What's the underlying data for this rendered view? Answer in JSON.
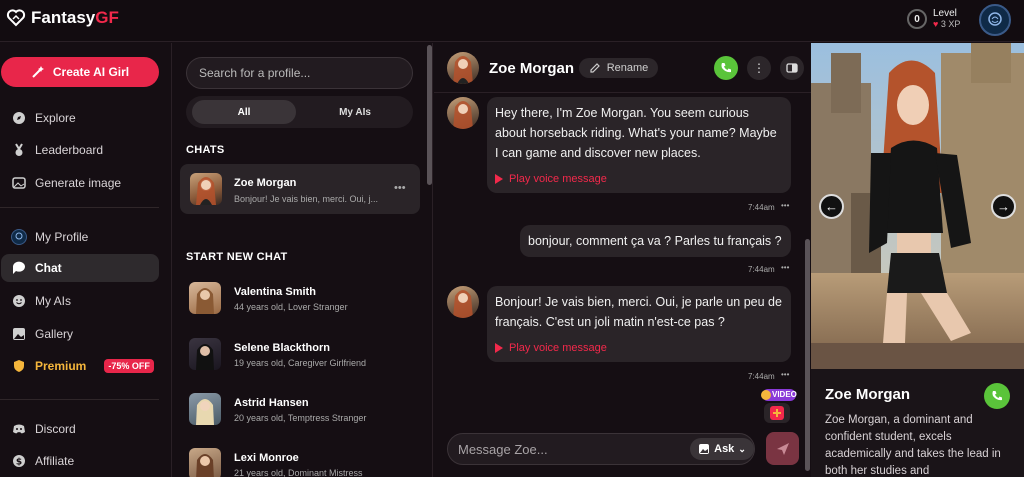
{
  "app": {
    "brand_a": "Fantasy",
    "brand_b": "GF",
    "level_label": "Level",
    "level_value": "0",
    "xp": "3 XP"
  },
  "sidebar": {
    "create_label": "Create AI Girl",
    "items": [
      {
        "label": "Explore",
        "icon": "compass-icon"
      },
      {
        "label": "Leaderboard",
        "icon": "medal-icon"
      },
      {
        "label": "Generate image",
        "icon": "image-icon"
      },
      {
        "label": "My Profile",
        "icon": "profile-icon"
      },
      {
        "label": "Chat",
        "icon": "chat-icon"
      },
      {
        "label": "My AIs",
        "icon": "smile-icon"
      },
      {
        "label": "Gallery",
        "icon": "gallery-icon"
      },
      {
        "label": "Premium",
        "icon": "shield-icon"
      },
      {
        "label": "Discord",
        "icon": "discord-icon"
      },
      {
        "label": "Affiliate",
        "icon": "dollar-icon"
      }
    ],
    "premium_discount": "-75% OFF"
  },
  "chatlist": {
    "search_placeholder": "Search for a profile...",
    "tab_all": "All",
    "tab_my_ais": "My AIs",
    "chats_title": "CHATS",
    "active_chat": {
      "name": "Zoe Morgan",
      "preview": "Bonjour! Je vais bien, merci. Oui, j..."
    },
    "start_title": "START NEW CHAT",
    "new_chats": [
      {
        "name": "Valentina Smith",
        "sub": "44 years old, Lover Stranger"
      },
      {
        "name": "Selene Blackthorn",
        "sub": "19 years old, Caregiver Girlfriend"
      },
      {
        "name": "Astrid Hansen",
        "sub": "20 years old, Temptress Stranger"
      },
      {
        "name": "Lexi Monroe",
        "sub": "21 years old, Dominant Mistress"
      }
    ]
  },
  "conversation": {
    "name": "Zoe Morgan",
    "rename_label": "Rename",
    "messages": [
      {
        "text": "Hey there, I'm Zoe Morgan. You seem curious about horseback riding. What's your name? Maybe I can game and discover new places.",
        "voice": "Play voice message",
        "time": "7:44am"
      },
      {
        "text": "bonjour, comment ça va ? Parles tu français ?",
        "time": "7:44am"
      },
      {
        "text": "Bonjour! Je vais bien, merci. Oui, je parle un peu de français. C'est un joli matin n'est-ce pas ?",
        "voice": "Play voice message",
        "time": "7:44am"
      }
    ],
    "video_label": "VIDEO",
    "composer_placeholder": "Message Zoe...",
    "ask_label": "Ask"
  },
  "profile": {
    "name": "Zoe Morgan",
    "description": "Zoe Morgan, a dominant and confident student, excels academically and takes the lead in both her studies and"
  },
  "colors": {
    "accent": "#e8264a",
    "call_green": "#5ac43a",
    "premium_gold": "#f5b63c"
  }
}
